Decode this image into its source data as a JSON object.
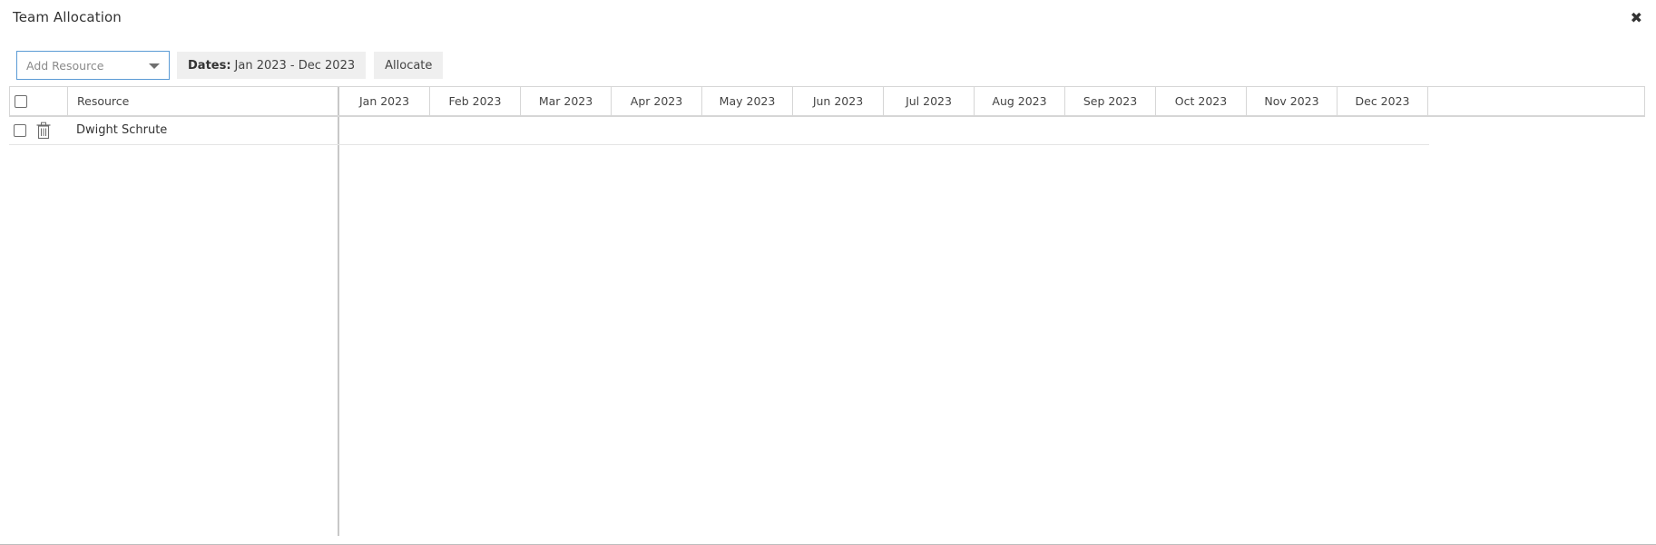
{
  "dialog": {
    "title": "Team Allocation",
    "close_icon": "close-icon",
    "close_glyph": "✖"
  },
  "toolbar": {
    "add_resource_placeholder": "Add Resource",
    "dates_label": "Dates:",
    "dates_value": "Jan 2023 - Dec 2023",
    "allocate_label": "Allocate"
  },
  "grid": {
    "resource_header": "Resource",
    "months": [
      "Jan 2023",
      "Feb 2023",
      "Mar 2023",
      "Apr 2023",
      "May 2023",
      "Jun 2023",
      "Jul 2023",
      "Aug 2023",
      "Sep 2023",
      "Oct 2023",
      "Nov 2023",
      "Dec 2023"
    ],
    "rows": [
      {
        "name": "Dwight Schrute",
        "checked": false
      }
    ]
  },
  "icons": {
    "trash": "trash-icon",
    "dropdown": "chevron-down-icon",
    "checkbox": "checkbox"
  },
  "colors": {
    "input_border": "#5b9bd5",
    "button_bg": "#efefef",
    "grid_line": "#d6d6d6"
  }
}
